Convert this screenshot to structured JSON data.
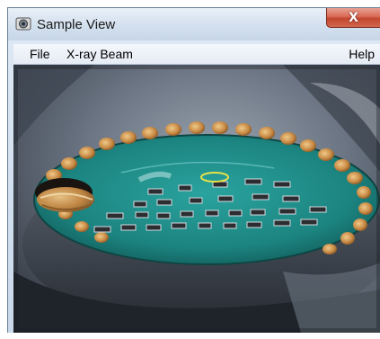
{
  "window": {
    "title": "Sample View",
    "close_label": "X"
  },
  "menu": {
    "file": "File",
    "xray_beam": "X-ray Beam",
    "help": "Help"
  },
  "colors": {
    "board_green": "#1f8a86",
    "pad_copper": "#c98a4a",
    "close_red": "#c9442c"
  },
  "icons": {
    "app": "camera-lens-icon",
    "close": "close-icon"
  }
}
